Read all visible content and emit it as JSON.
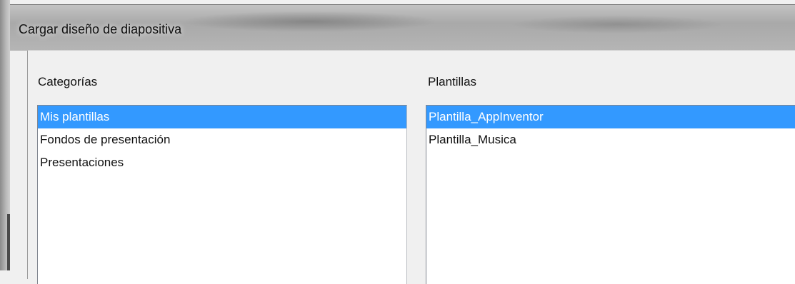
{
  "window": {
    "title": "Cargar diseño de diapositiva"
  },
  "categories": {
    "label": "Categorías",
    "items": [
      {
        "label": "Mis plantillas",
        "selected": true
      },
      {
        "label": "Fondos de presentación",
        "selected": false
      },
      {
        "label": "Presentaciones",
        "selected": false
      }
    ]
  },
  "templates": {
    "label": "Plantillas",
    "items": [
      {
        "label": "Plantilla_AppInventor",
        "selected": true
      },
      {
        "label": "Plantilla_Musica",
        "selected": false
      }
    ]
  },
  "colors": {
    "selection": "#3399ff",
    "dialog_bg": "#f0f0f0"
  }
}
